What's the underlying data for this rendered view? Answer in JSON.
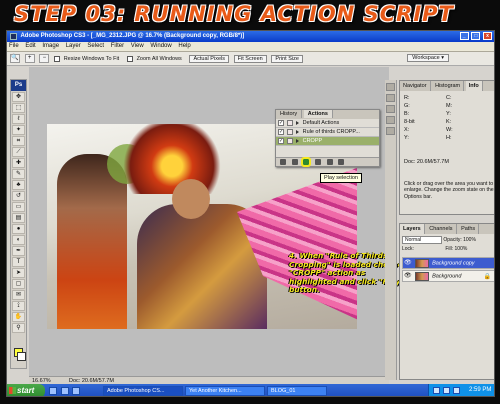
{
  "heading": "STEP 03: RUNNING ACTION SCRIPT",
  "window": {
    "title": "Adobe Photoshop CS3 - [_MG_2312.JPG @ 16.7% (Background copy, RGB/8*)]",
    "minimize": "_",
    "maximize": "□",
    "close": "x"
  },
  "menu": [
    "File",
    "Edit",
    "Image",
    "Layer",
    "Select",
    "Filter",
    "View",
    "Window",
    "Help"
  ],
  "options_bar": {
    "resize_windows": "Resize Windows To Fit",
    "zoom_all": "Zoom All Windows",
    "actual_pixels": "Actual Pixels",
    "fit_screen": "Fit Screen",
    "print_size": "Print Size",
    "workspace": "Workspace ▾"
  },
  "toolbox": {
    "logo": "Ps"
  },
  "actions_panel": {
    "tabs": [
      "History",
      "Actions"
    ],
    "rows": [
      {
        "name": "Default Actions",
        "checked": "✓"
      },
      {
        "name": "Rule of thirds CROPP...",
        "checked": "✓"
      },
      {
        "name": "CROPP",
        "checked": "✓"
      }
    ],
    "tooltip": "Play selection"
  },
  "annotation": "4. When \"Rule of Thirds Cropping\" is loaded choose \"CROPP\" action as highlighted and click \"Play\" button.",
  "status_bar": {
    "zoom": "16.67%",
    "doc": "Doc: 20.6M/57.7M"
  },
  "info_panel": {
    "tabs": [
      "Navigator",
      "Histogram",
      "Info"
    ],
    "rows": [
      [
        "R:",
        "C:"
      ],
      [
        "G:",
        "M:"
      ],
      [
        "B:",
        "Y:"
      ],
      [
        "8-bit",
        "K:"
      ],
      [
        "X:",
        "W:"
      ],
      [
        "Y:",
        "H:"
      ]
    ],
    "doc": "Doc: 20.6M/57.7M",
    "help": "Click or drag over the area you want to enlarge. Change the zoom state on the Options bar."
  },
  "layers_panel": {
    "tabs": [
      "Layers",
      "Channels",
      "Paths"
    ],
    "blend_mode": "Normal",
    "opacity_label": "Opacity:",
    "opacity_value": "100%",
    "lock_label": "Lock:",
    "fill_label": "Fill:",
    "fill_value": "100%",
    "layers": [
      {
        "name": "Background copy",
        "active": true
      },
      {
        "name": "Background",
        "active": false
      }
    ]
  },
  "taskbar": {
    "start": "start",
    "tasks": [
      "Adobe Photoshop CS...",
      "Yet Another Kitchen...",
      "BLOG_01"
    ],
    "clock": "2:59 PM"
  },
  "colors": {
    "heading": "#e85a18",
    "annotation": "#f4e81f",
    "selected_action": "#9ab06a",
    "active_layer": "#3d5ccf"
  }
}
